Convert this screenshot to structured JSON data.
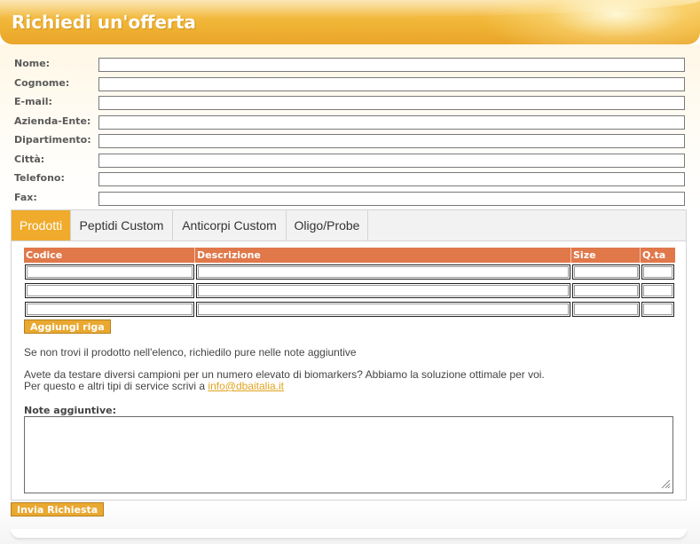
{
  "header": {
    "title": "Richiedi un'offerta"
  },
  "form": {
    "fields": [
      {
        "label": "Nome:",
        "value": ""
      },
      {
        "label": "Cognome:",
        "value": ""
      },
      {
        "label": "E-mail:",
        "value": ""
      },
      {
        "label": "Azienda-Ente:",
        "value": ""
      },
      {
        "label": "Dipartimento:",
        "value": ""
      },
      {
        "label": "Città:",
        "value": ""
      },
      {
        "label": "Telefono:",
        "value": ""
      },
      {
        "label": "Fax:",
        "value": ""
      }
    ]
  },
  "tabs": [
    {
      "label": "Prodotti",
      "active": true
    },
    {
      "label": "Peptidi Custom",
      "active": false
    },
    {
      "label": "Anticorpi Custom",
      "active": false
    },
    {
      "label": "Oligo/Probe",
      "active": false
    }
  ],
  "products_table": {
    "columns": [
      "Codice",
      "Descrizione",
      "Size",
      "Q.ta"
    ],
    "rows": [
      [
        "",
        "",
        "",
        ""
      ],
      [
        "",
        "",
        "",
        ""
      ],
      [
        "",
        "",
        "",
        ""
      ]
    ]
  },
  "add_row_label": "Aggiungi riga",
  "info": {
    "line1": "Se non trovi il prodotto nell'elenco, richiedilo pure nelle note aggiuntive",
    "line2": "Avete da testare diversi campioni per un numero elevato di biomarkers? Abbiamo la soluzione ottimale per voi.",
    "line3_prefix": "Per questo e altri tipi di service scrivi a ",
    "email": "info@dbaitalia.it"
  },
  "notes": {
    "label": "Note aggiuntive:",
    "value": ""
  },
  "submit_label": "Invia Richiesta",
  "colors": {
    "accent": "#f0ab2c",
    "table_header": "#e0784a",
    "link": "#e0a420"
  }
}
